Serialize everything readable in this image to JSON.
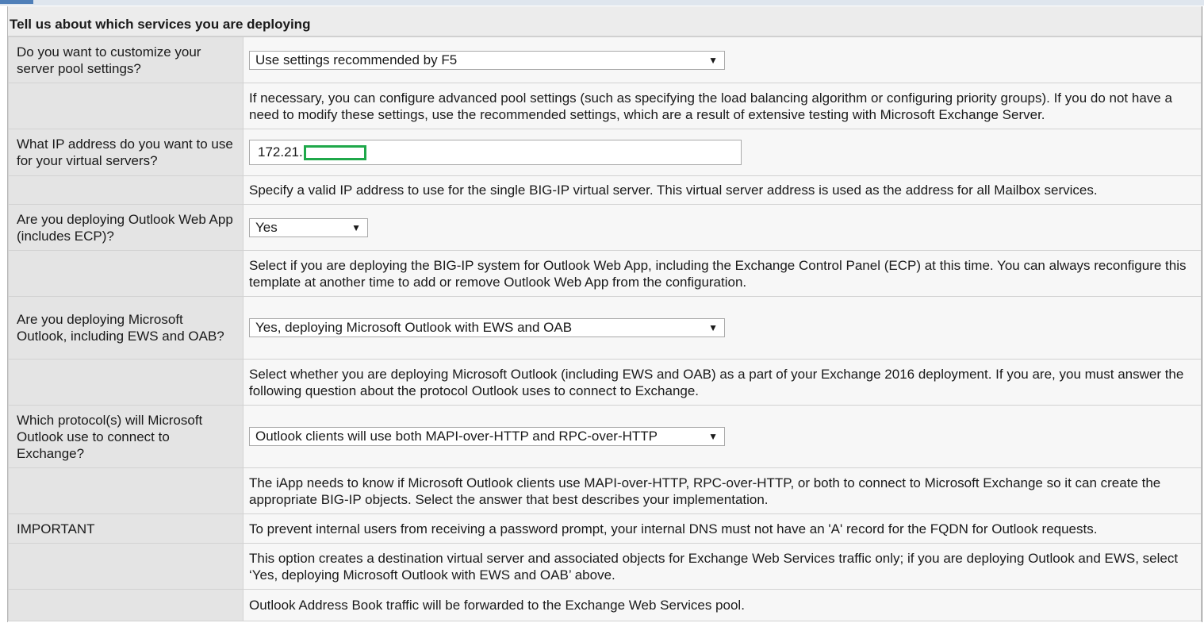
{
  "section_title": "Tell us about which services you are deploying",
  "pool": {
    "question": "Do you want to customize your server pool settings?",
    "selected": "Use settings recommended by F5",
    "help": "If necessary, you can configure advanced pool settings (such as specifying the load balancing algorithm or configuring priority groups). If you do not have a need to modify these settings, use the recommended settings, which are a result of extensive testing with Microsoft Exchange Server."
  },
  "ip": {
    "question": "What IP address do you want to use for your virtual servers?",
    "value": "172.21.",
    "help": "Specify a valid IP address to use for the single BIG-IP virtual server. This virtual server address is used as the address for all Mailbox services."
  },
  "owa": {
    "question": "Are you deploying Outlook Web App (includes ECP)?",
    "selected": "Yes",
    "help": "Select if you are deploying the BIG-IP system for Outlook Web App, including the Exchange Control Panel (ECP) at this time. You can always reconfigure this template at another time to add or remove Outlook Web App from the configuration."
  },
  "outlook": {
    "question": "Are you deploying Microsoft Outlook, including EWS and OAB?",
    "selected": "Yes, deploying Microsoft Outlook with EWS and OAB",
    "help": "Select whether you are deploying Microsoft Outlook (including EWS and OAB) as a part of your Exchange 2016 deployment. If you are, you must answer the following question about the protocol Outlook uses to connect to Exchange."
  },
  "protocol": {
    "question": "Which protocol(s) will Microsoft Outlook use to connect to Exchange?",
    "selected": "Outlook clients will use both MAPI-over-HTTP and RPC-over-HTTP",
    "help": "The iApp needs to know if Microsoft Outlook clients use MAPI-over-HTTP, RPC-over-HTTP, or both to connect to Microsoft Exchange so it can create the appropriate BIG-IP objects. Select the answer that best describes your implementation."
  },
  "important": {
    "label": "IMPORTANT",
    "text": "To prevent internal users from receiving a password prompt, your internal DNS must not have an 'A' record for the FQDN for Outlook requests."
  },
  "ews_note": "This option creates a destination virtual server and associated objects for Exchange Web Services traffic only; if you are deploying Outlook and EWS, select ‘Yes, deploying Microsoft Outlook with EWS and OAB’ above.",
  "oab_note": "Outlook Address Book traffic will be forwarded to the Exchange Web Services pool.",
  "arrow_glyph": "▼",
  "colors": {
    "label_bg": "#e4e4e4",
    "value_bg": "#f7f7f7",
    "redaction_box": "#1fa84a",
    "top_accent": "#4f7fb8"
  }
}
